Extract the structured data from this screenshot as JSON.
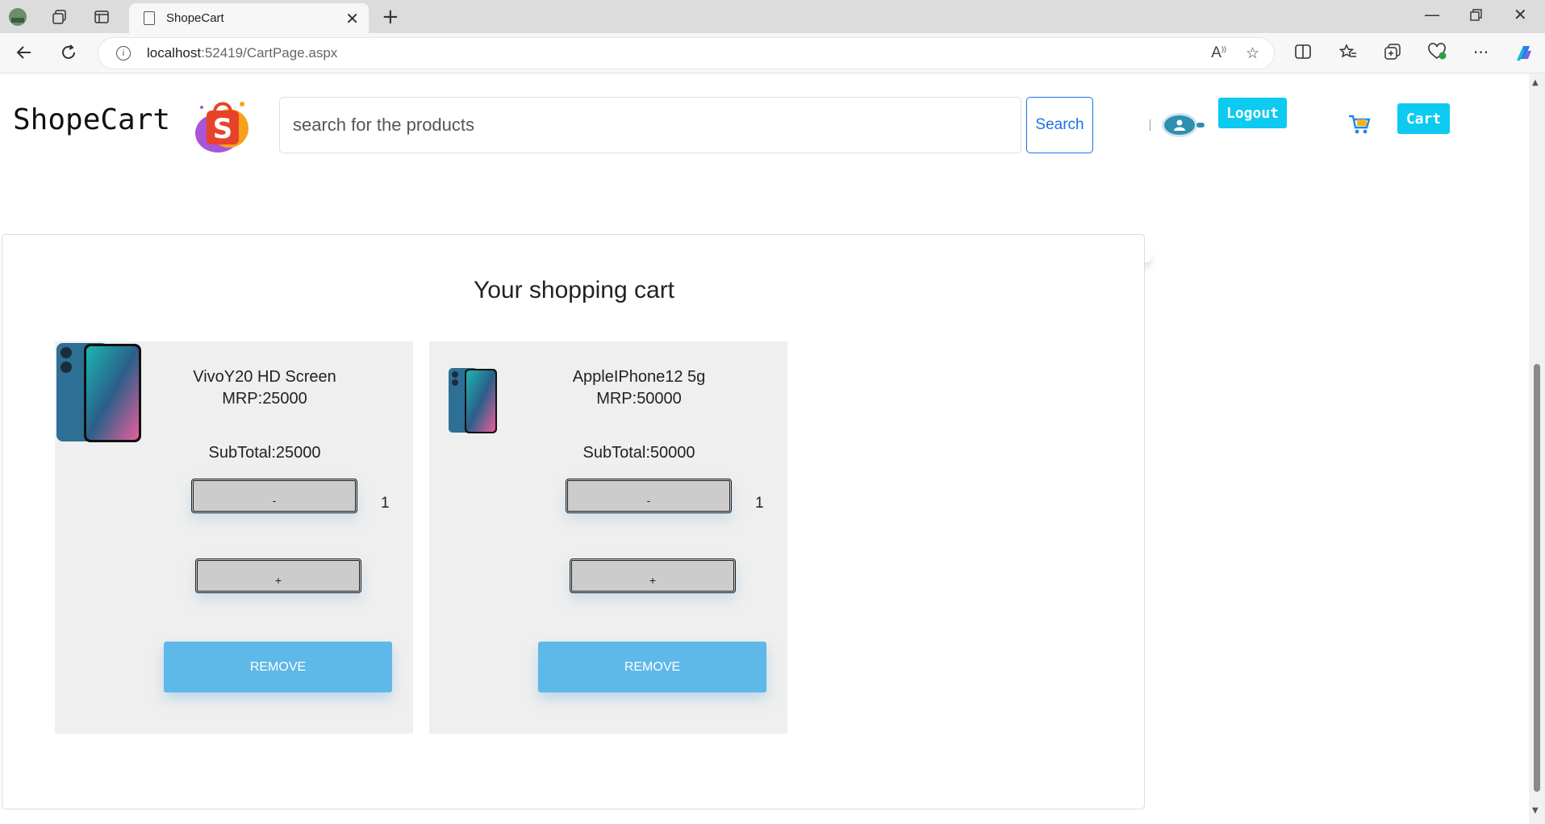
{
  "browser": {
    "tab_title": "ShopeCart",
    "url_host": "localhost",
    "url_rest": ":52419/CartPage.aspx"
  },
  "header": {
    "brand": "ShopeCart",
    "logo_letter": "S",
    "search_placeholder": "search for the products",
    "search_label": "Search",
    "logout_label": "Logout",
    "cart_label": "Cart"
  },
  "cart": {
    "title": "Your shopping cart",
    "remove_label": "REMOVE",
    "decrement_label": "-",
    "increment_label": "+",
    "items": [
      {
        "name": "VivoY20 HD Screen",
        "mrp": "MRP:25000",
        "subtotal": "SubTotal:25000",
        "quantity": "1"
      },
      {
        "name": "AppleIPhone12 5g",
        "mrp": "MRP:50000",
        "subtotal": "SubTotal:50000",
        "quantity": "1"
      }
    ]
  },
  "colors": {
    "accent": "#0dcaf0",
    "remove": "#5eb8e8",
    "search_border": "#1a73e8"
  }
}
